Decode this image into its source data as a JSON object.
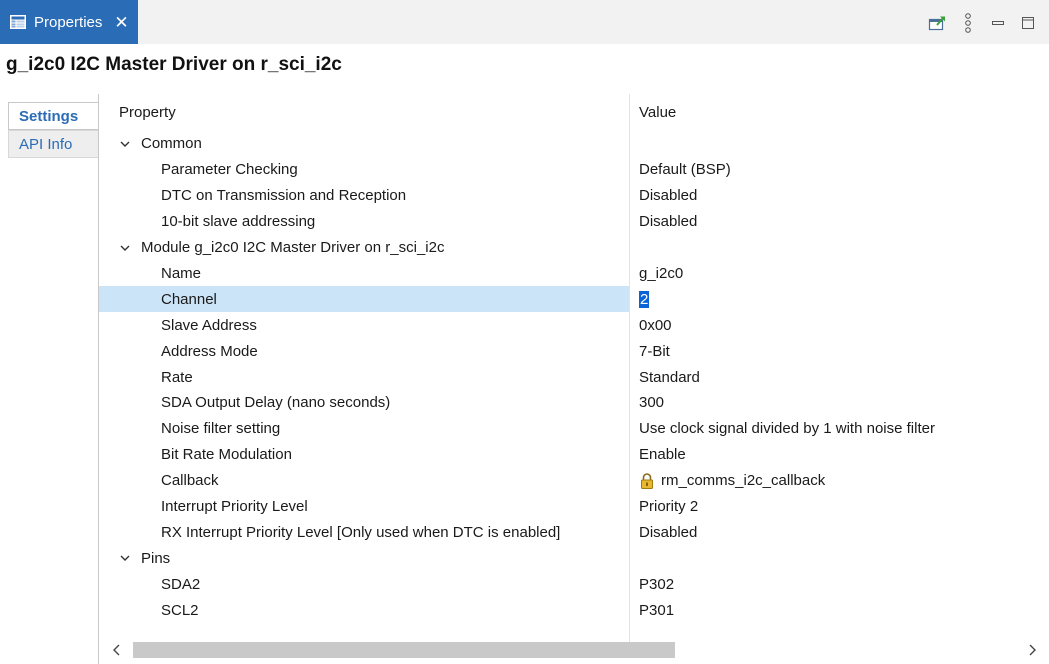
{
  "view": {
    "tab_label": "Properties",
    "close_glyph": "✕",
    "title": "g_i2c0 I2C Master Driver on r_sci_i2c"
  },
  "toolbar_icons": [
    "export-icon",
    "view-menu-icon",
    "minimize-icon",
    "maximize-icon"
  ],
  "side_tabs": [
    {
      "label": "Settings",
      "active": true
    },
    {
      "label": "API Info",
      "active": false
    }
  ],
  "table": {
    "header_property": "Property",
    "header_value": "Value",
    "rows": [
      {
        "property": "Common",
        "value": "",
        "group": true
      },
      {
        "property": "Parameter Checking",
        "value": "Default (BSP)"
      },
      {
        "property": "DTC on Transmission and Reception",
        "value": "Disabled"
      },
      {
        "property": "10-bit slave addressing",
        "value": "Disabled"
      },
      {
        "property": "Module g_i2c0 I2C Master Driver on r_sci_i2c",
        "value": "",
        "group": true
      },
      {
        "property": "Name",
        "value": "g_i2c0"
      },
      {
        "property": "Channel",
        "value": "2",
        "selected": true
      },
      {
        "property": "Slave Address",
        "value": "0x00"
      },
      {
        "property": "Address Mode",
        "value": "7-Bit"
      },
      {
        "property": "Rate",
        "value": "Standard"
      },
      {
        "property": "SDA Output Delay (nano seconds)",
        "value": "300"
      },
      {
        "property": "Noise filter setting",
        "value": "Use clock signal divided by 1 with noise filter"
      },
      {
        "property": "Bit Rate Modulation",
        "value": "Enable"
      },
      {
        "property": "Callback",
        "value": "rm_comms_i2c_callback",
        "locked": true
      },
      {
        "property": "Interrupt Priority Level",
        "value": "Priority 2"
      },
      {
        "property": "RX Interrupt Priority Level [Only used when DTC is enabled]",
        "value": "Disabled"
      },
      {
        "property": "Pins",
        "value": "",
        "group": true
      },
      {
        "property": "SDA2",
        "value": "P302"
      },
      {
        "property": "SCL2",
        "value": "P301"
      }
    ]
  },
  "colors": {
    "accent": "#2b6cb6",
    "selection_row": "#cce4f7",
    "selection_text": "#0a64d6"
  }
}
